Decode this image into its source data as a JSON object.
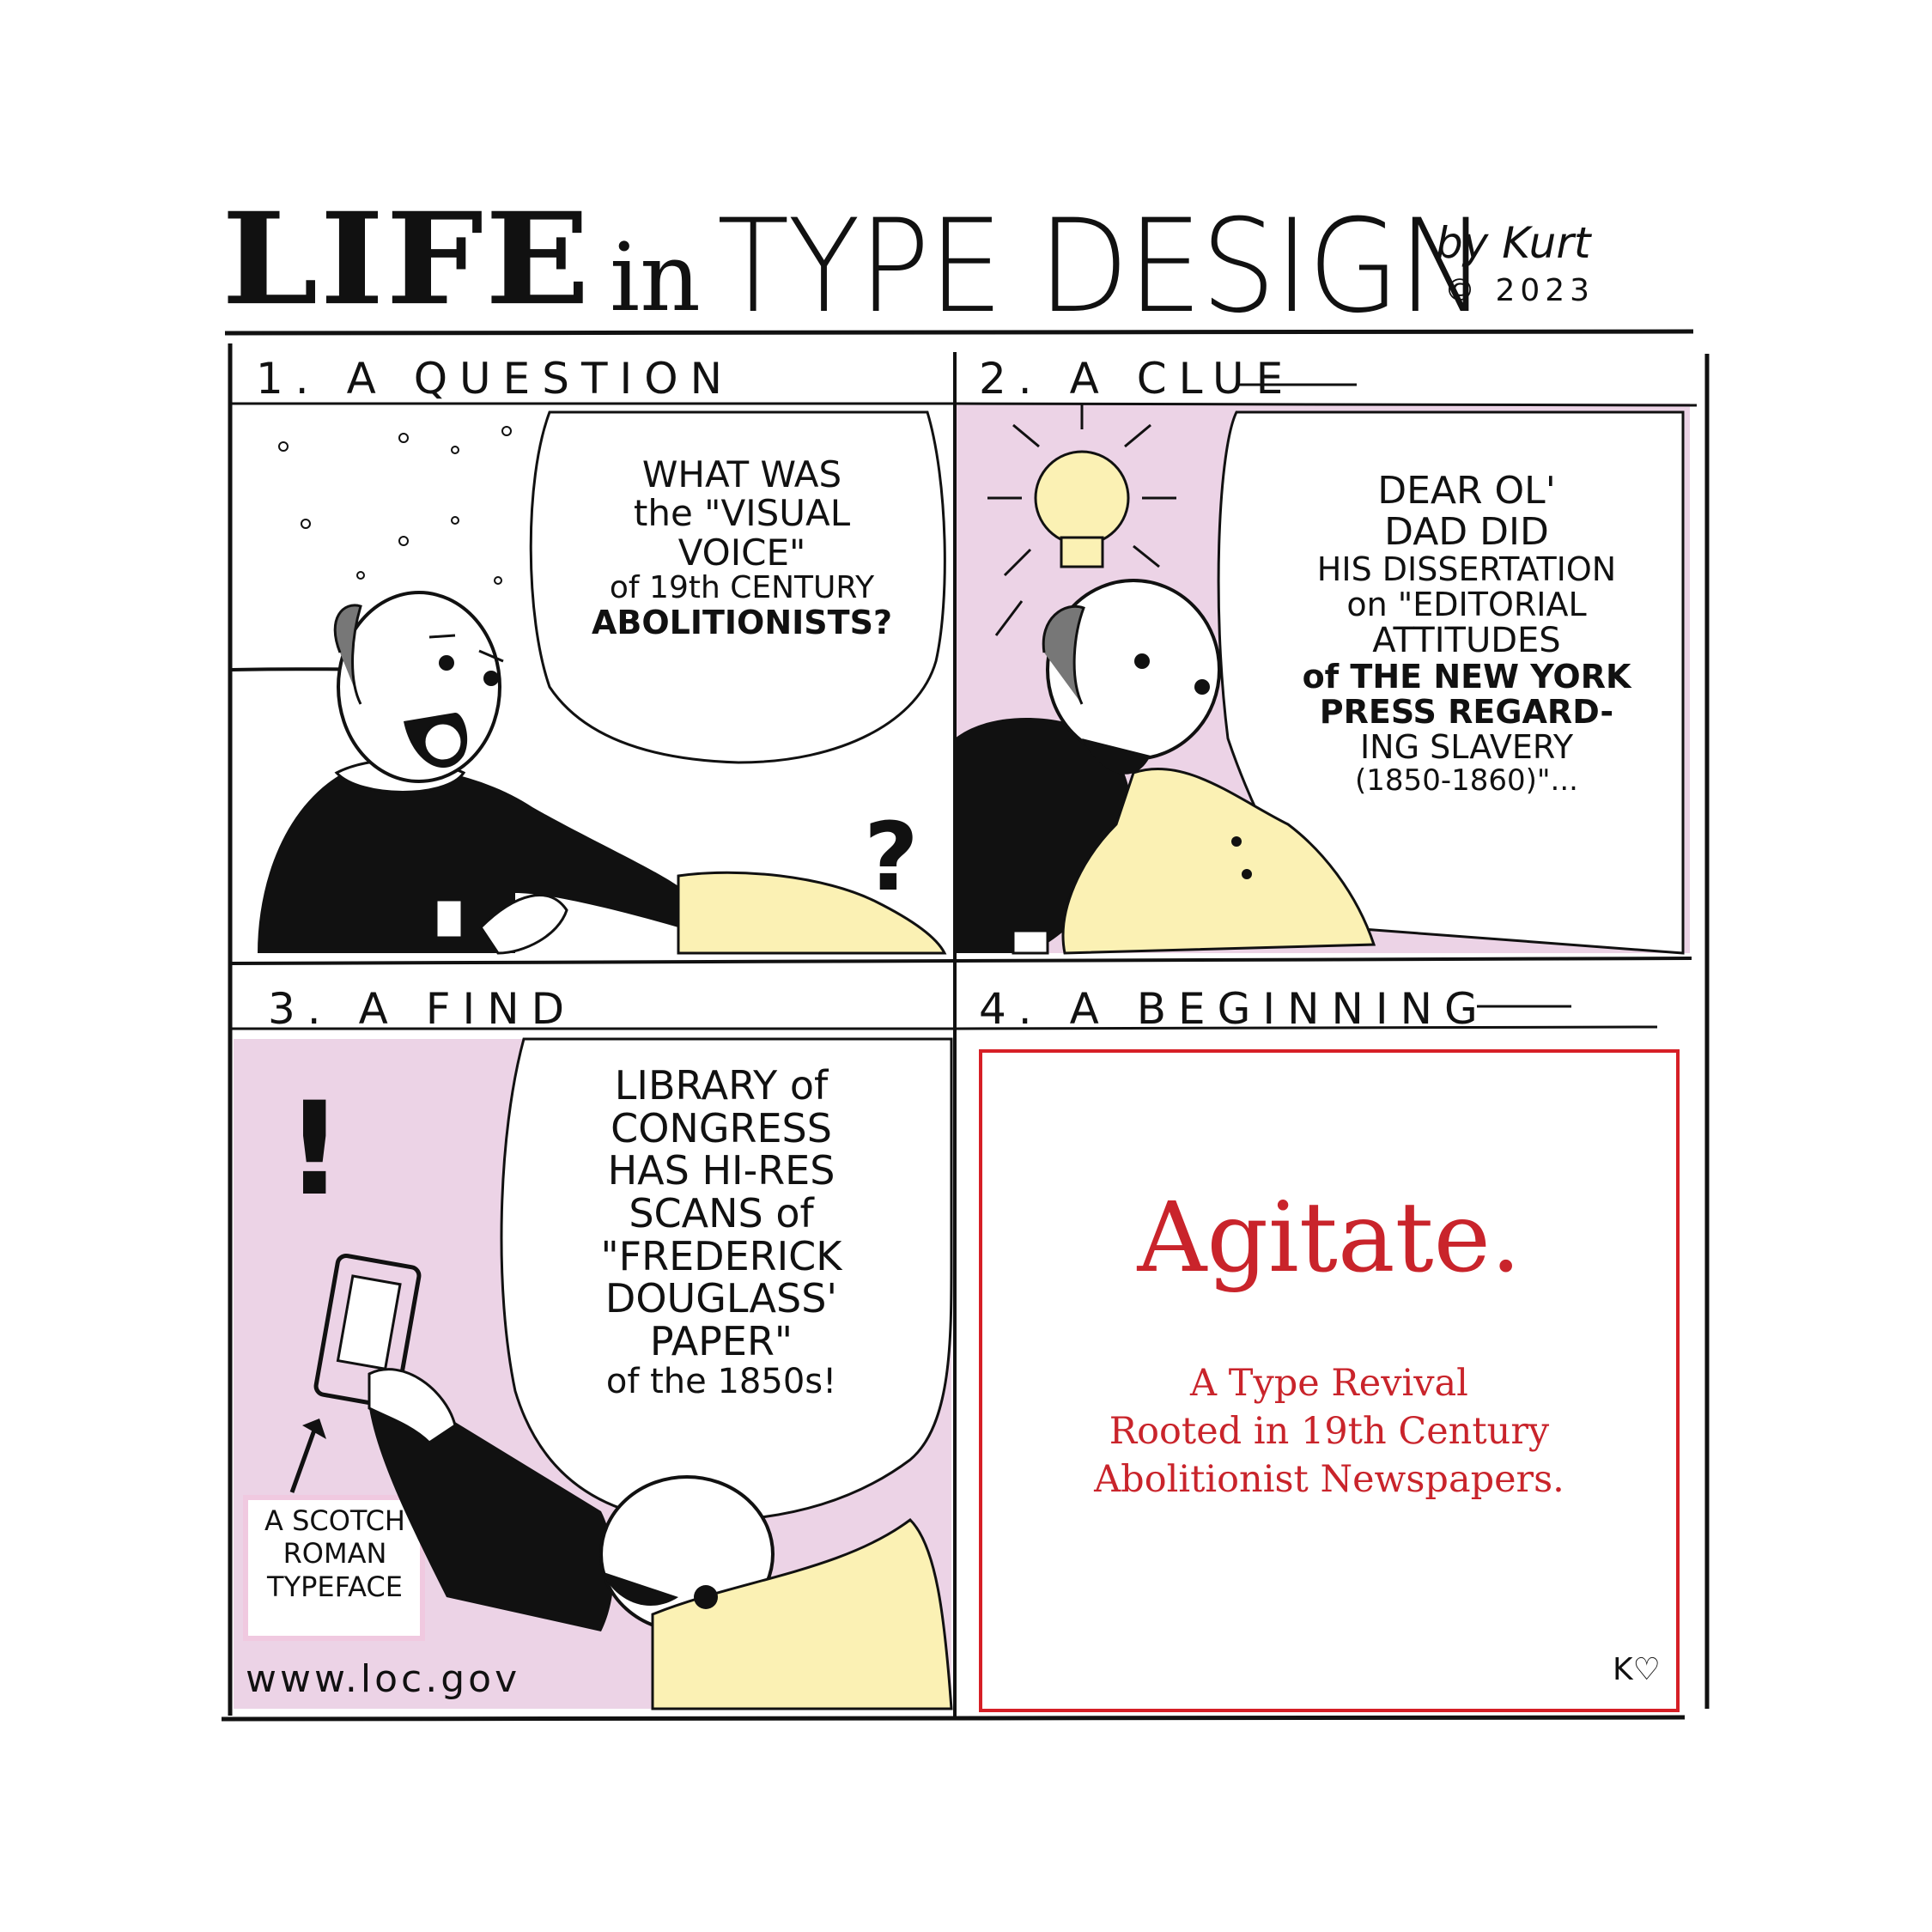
{
  "header": {
    "life": "LIFE",
    "in": "in",
    "type_design": "TYPE DESIGN",
    "byline": "by Kurt",
    "copyright": "© 2023"
  },
  "panels": [
    {
      "label": "1. A QUESTION",
      "speech": [
        "WHAT WAS",
        "the \"VISUAL",
        "VOICE\"",
        "of 19th CENTURY",
        "ABOLITIONISTS?"
      ],
      "mark": "?"
    },
    {
      "label": "2. A CLUE",
      "speech": [
        "DEAR OL'",
        "DAD DID",
        "HIS DISSERTATION",
        "on \"EDITORIAL",
        "ATTITUDES",
        "of THE NEW YORK",
        "PRESS REGARD-",
        "ING SLAVERY",
        "(1850-1860)\"..."
      ]
    },
    {
      "label": "3. A FIND",
      "speech": [
        "LIBRARY of",
        "CONGRESS",
        "HAS HI-RES",
        "SCANS of",
        "\"FREDERICK",
        "DOUGLASS'",
        "PAPER\"",
        "of the 1850s!"
      ],
      "caption": [
        "A SCOTCH",
        "ROMAN",
        "TYPEFACE"
      ],
      "url": "www.loc.gov",
      "mark": "!"
    },
    {
      "label": "4. A BEGINNING",
      "headline": "Agitate.",
      "tagline": [
        "A Type Revival",
        "Rooted in 19th Century",
        "Abolitionist Newspapers."
      ],
      "signature": "K♡"
    }
  ],
  "colors": {
    "ink": "#111111",
    "pink": "#ecd3e6",
    "dog_yellow": "#fbf1b4",
    "red": "#c9242b",
    "frame_red": "#d61f26"
  }
}
